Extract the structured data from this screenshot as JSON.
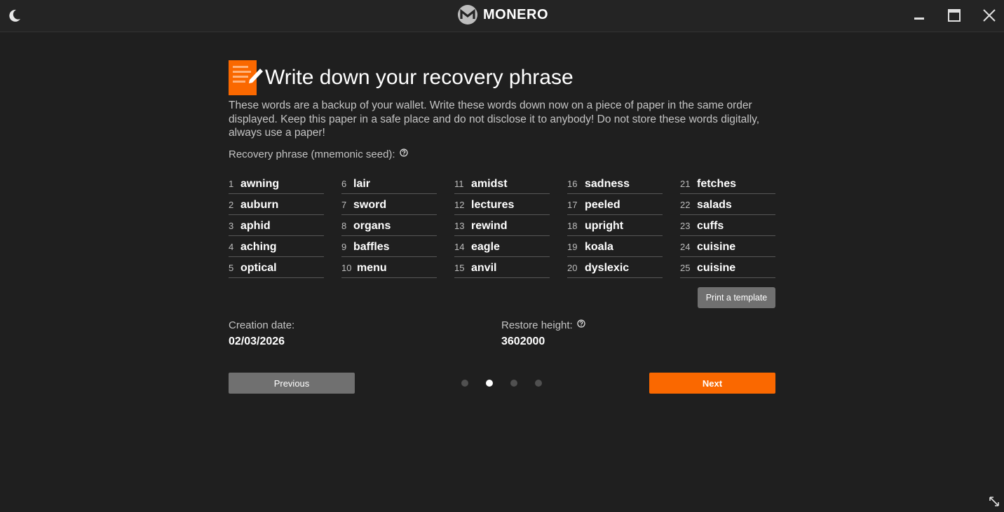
{
  "app": {
    "name": "MONERO"
  },
  "colors": {
    "accent": "#fa6800",
    "background": "#1f1f1f",
    "button_gray": "#707070"
  },
  "header": {
    "title": "Write down your recovery phrase"
  },
  "description": "These words are a backup of your wallet. Write these words down now on a piece of paper in the same order displayed. Keep this paper in a safe place and do not disclose it to anybody! Do not store these words digitally, always use a paper!",
  "seed": {
    "label": "Recovery phrase (mnemonic seed):",
    "columns": [
      [
        {
          "num": "1",
          "word": "awning"
        },
        {
          "num": "2",
          "word": "auburn"
        },
        {
          "num": "3",
          "word": "aphid"
        },
        {
          "num": "4",
          "word": "aching"
        },
        {
          "num": "5",
          "word": "optical"
        }
      ],
      [
        {
          "num": "6",
          "word": "lair"
        },
        {
          "num": "7",
          "word": "sword"
        },
        {
          "num": "8",
          "word": "organs"
        },
        {
          "num": "9",
          "word": "baffles"
        },
        {
          "num": "10",
          "word": "menu"
        }
      ],
      [
        {
          "num": "11",
          "word": "amidst"
        },
        {
          "num": "12",
          "word": "lectures"
        },
        {
          "num": "13",
          "word": "rewind"
        },
        {
          "num": "14",
          "word": "eagle"
        },
        {
          "num": "15",
          "word": "anvil"
        }
      ],
      [
        {
          "num": "16",
          "word": "sadness"
        },
        {
          "num": "17",
          "word": "peeled"
        },
        {
          "num": "18",
          "word": "upright"
        },
        {
          "num": "19",
          "word": "koala"
        },
        {
          "num": "20",
          "word": "dyslexic"
        }
      ],
      [
        {
          "num": "21",
          "word": "fetches"
        },
        {
          "num": "22",
          "word": "salads"
        },
        {
          "num": "23",
          "word": "cuffs"
        },
        {
          "num": "24",
          "word": "cuisine"
        },
        {
          "num": "25",
          "word": "cuisine"
        }
      ]
    ]
  },
  "print_button": "Print a template",
  "creation": {
    "label": "Creation date:",
    "value": "02/03/2026"
  },
  "restore": {
    "label": "Restore height:",
    "value": "3602000"
  },
  "nav": {
    "previous": "Previous",
    "next": "Next",
    "pages_total": 4,
    "active_page": 2
  }
}
